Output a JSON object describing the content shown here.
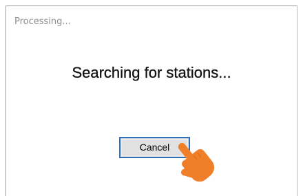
{
  "dialog": {
    "title": "Processing...",
    "message": "Searching for stations...",
    "cancel_label": "Cancel"
  },
  "colors": {
    "button_border": "#2f6fb5",
    "button_bg": "#e1e1e1",
    "cursor_hand": "#f07f2a"
  },
  "icons": {
    "cursor": "hand-pointer-icon"
  }
}
